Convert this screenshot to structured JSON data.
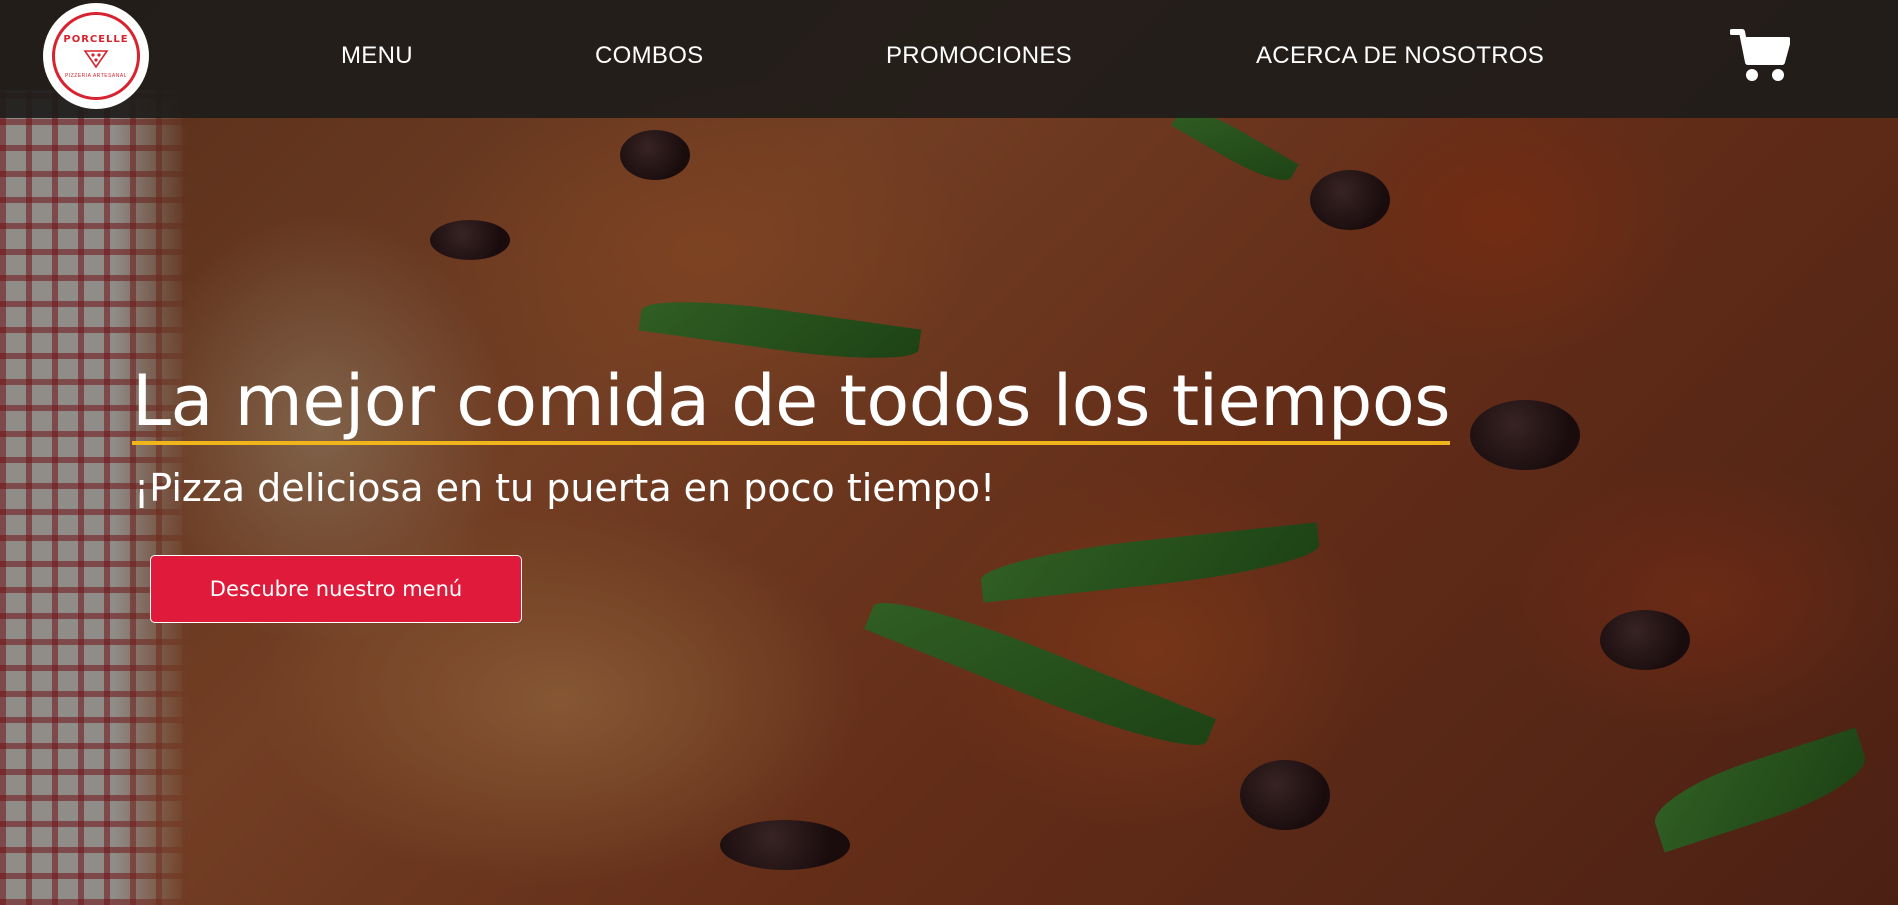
{
  "header": {
    "logo_brand": "PORCELLE",
    "logo_tagline": "PIZZERIA ARTESANAL",
    "nav": [
      {
        "label": "MENU"
      },
      {
        "label": "COMBOS"
      },
      {
        "label": "PROMOCIONES"
      },
      {
        "label": "ACERCA DE NOSOTROS"
      }
    ],
    "cart_icon": "shopping-cart-icon"
  },
  "hero": {
    "title": "La mejor comida de todos los tiempos",
    "subtitle": "¡Pizza deliciosa en tu puerta en poco tiempo!",
    "cta_label": "Descubre nuestro menú"
  },
  "colors": {
    "header_bg": "#1e1c1a",
    "accent_red": "#df1a3a",
    "underline_yellow": "#f0b41c",
    "logo_red": "#d8222f"
  }
}
